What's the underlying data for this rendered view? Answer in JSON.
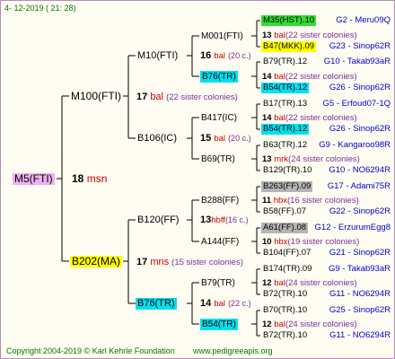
{
  "header": {
    "date": "4- 12-2019 ( 21: 28)"
  },
  "footer": {
    "copyright": "Copyright 2004-2019 © Karl Kehrle Foundation",
    "website": "www.pedigreeapis.org"
  },
  "root": {
    "name": "M5(FTI)",
    "num": "18",
    "unit": "msn"
  },
  "g1": [
    {
      "name": "M100(FTI)",
      "num": "17",
      "unit": "bal",
      "note": "(22 sister colonies)"
    },
    {
      "name": "B202(MA)",
      "num": "17",
      "unit": "mns",
      "note": "(15 sister colonies)"
    }
  ],
  "g2": [
    {
      "name": "M10(FTI)",
      "num": "16",
      "unit": "bal",
      "note": "(20 c.)"
    },
    {
      "name": "B106(IC)",
      "num": "15",
      "unit": "bal",
      "note": "(20 c.)"
    },
    {
      "name": "B120(FF)",
      "num": "13",
      "unit": "hbff",
      "note": "(16 c.)"
    },
    {
      "name": "B76(TR)",
      "num": "14",
      "unit": "bal",
      "note": "(22 c.)"
    }
  ],
  "g3": [
    {
      "name": "M001(FTI)"
    },
    {
      "name": "B76(TR)"
    },
    {
      "name": "B417(IC)"
    },
    {
      "name": "B69(TR)"
    },
    {
      "name": "B288(FF)"
    },
    {
      "name": "A144(FF)"
    },
    {
      "name": "B79(TR)"
    },
    {
      "name": "B54(TR)"
    }
  ],
  "g3info": [
    {
      "num": "13",
      "unit": "bal",
      "note": "(22 sister colonies)"
    },
    {
      "num": "14",
      "unit": "bal",
      "note": "(22 sister colonies)"
    },
    {
      "num": "14",
      "unit": "bal",
      "note": "(22 sister colonies)"
    },
    {
      "num": "13",
      "unit": "mrk",
      "note": "(24 sister colonies)"
    },
    {
      "num": "11",
      "unit": "hbx",
      "note": "(16 sister colonies)"
    },
    {
      "num": "10",
      "unit": "hbx",
      "note": "(19 sister colonies)"
    },
    {
      "num": "12",
      "unit": "bal",
      "note": "(24 sister colonies)"
    },
    {
      "num": "12",
      "unit": "bal",
      "note": "(24 sister colonies)"
    }
  ],
  "g4": [
    {
      "name": "M35(HST).10",
      "ref": "G2 - Meru09Q"
    },
    {
      "name": "B47(MKK).09",
      "ref": "G23 - Sinop62R"
    },
    {
      "name": "B79(TR).12",
      "ref": "G10 - Takab93aR"
    },
    {
      "name": "B54(TR).12",
      "ref": "G26 - Sinop62R"
    },
    {
      "name": "B17(TR).13",
      "ref": "G5 - Erfoud07-1Q"
    },
    {
      "name": "B54(TR).12",
      "ref": "G26 - Sinop62R"
    },
    {
      "name": "B63(TR).12",
      "ref": "G9 - Kangaroo98R"
    },
    {
      "name": "B129(TR).10",
      "ref": "G10 - NO6294R"
    },
    {
      "name": "B263(FF).09",
      "ref": "G17 - Adami75R"
    },
    {
      "name": "B58(FF).07",
      "ref": "G22 - Sinop62R"
    },
    {
      "name": "A61(FF).08",
      "ref": "G12 - ErzurumEgg8"
    },
    {
      "name": "B104(FF).07",
      "ref": "G21 - Sinop62R"
    },
    {
      "name": "B174(TR).09",
      "ref": "G9 - Takab93aR"
    },
    {
      "name": "B72(TR).10",
      "ref": "G11 - NO6294R"
    },
    {
      "name": "B70(TR).10",
      "ref": "G25 - Sinop62R"
    },
    {
      "name": "B72(TR).10",
      "ref": "G11 - NO6294R"
    }
  ],
  "colors": {
    "pink": "#f0b0f0",
    "yellow": "#ffff00",
    "cyan": "#00e0f0",
    "green": "#33dd33",
    "grey": "#b5b5b5",
    "red": "#cc0000",
    "blue": "#0000cc",
    "purple": "#7a2d9a",
    "footer_green": "#007700"
  }
}
